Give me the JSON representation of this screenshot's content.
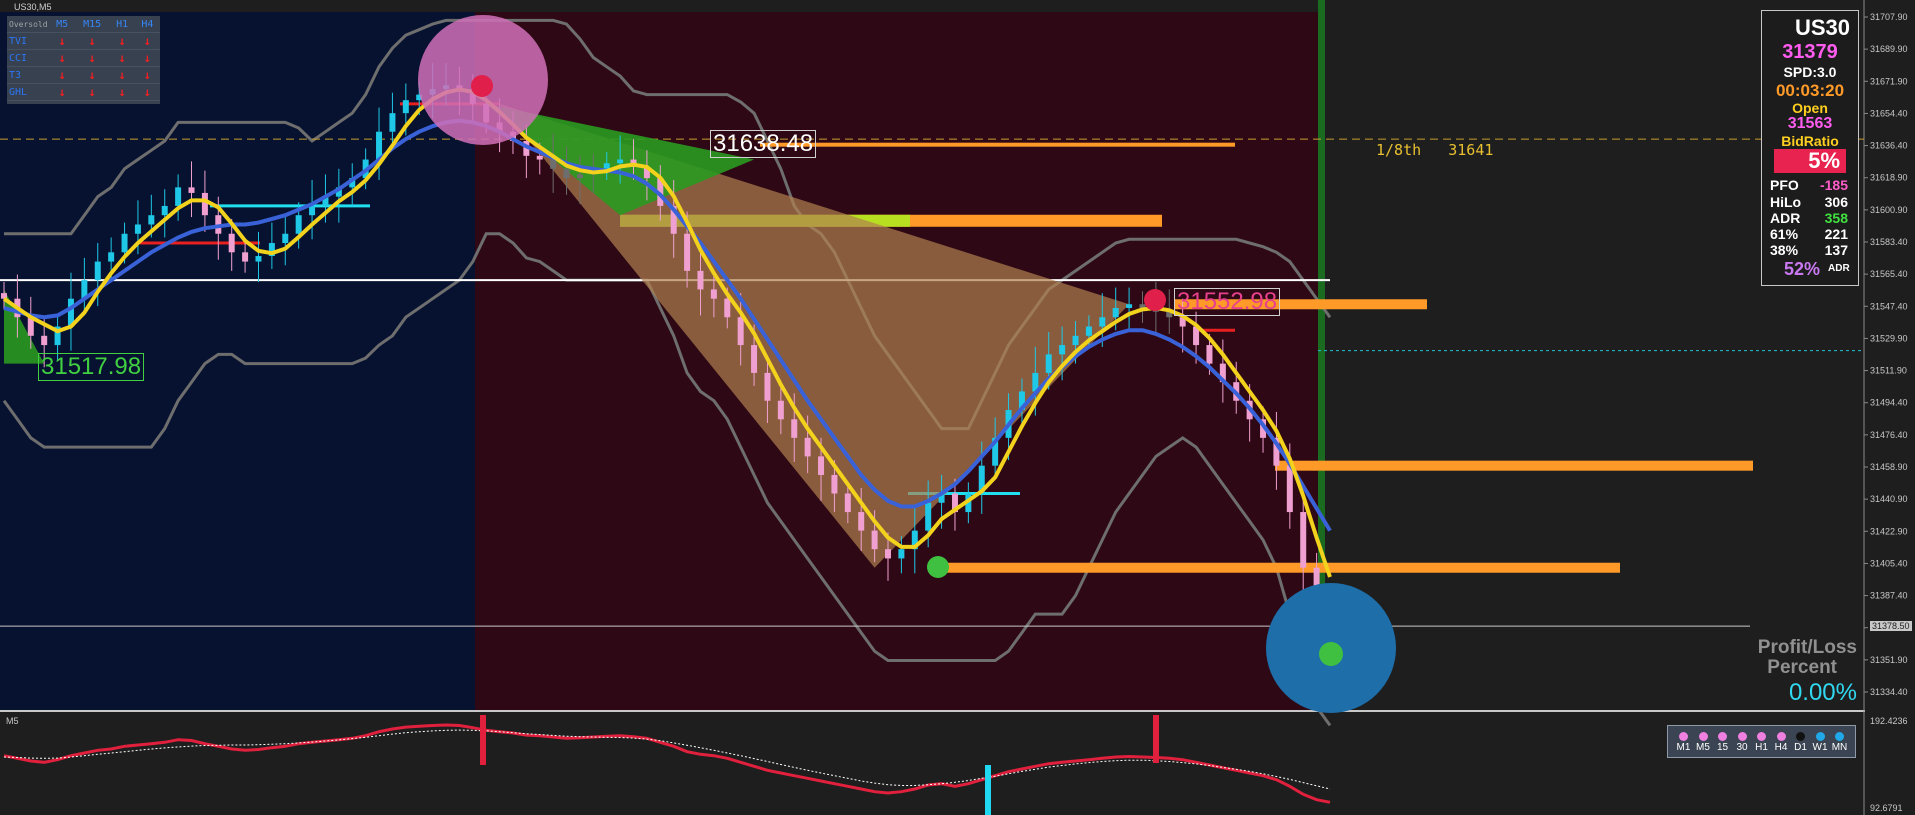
{
  "window": {
    "title": "US30,M5"
  },
  "colors": {
    "bg_left": "#071230",
    "bg_right": "#2e0814",
    "bg_panel": "#1e1e1e",
    "bull_candle": "#1ec8e6",
    "bear_candle": "#f0a0d0",
    "neutral_candle": "#6e6e6e",
    "ma_blue": "#3a62d8",
    "ma_yellow": "#f2d21c",
    "channel": "#6e6e6e",
    "orange_level": "#ff9a28",
    "lime_level": "#b8e020",
    "cyan_level": "#20e0f0",
    "red_level": "#e82020",
    "oscillator_cyan": "#20d8f0",
    "oscillator_red": "#e0203c"
  },
  "signal_table": {
    "header": [
      "Oversold",
      "M5",
      "M15",
      "H1",
      "H4"
    ],
    "rows": [
      {
        "name": "TVI",
        "arrows": [
          "↓",
          "↓",
          "↓",
          "↓"
        ]
      },
      {
        "name": "CCI",
        "arrows": [
          "↓",
          "↓",
          "↓",
          "↓"
        ]
      },
      {
        "name": "T3",
        "arrows": [
          "↓",
          "↓",
          "↓",
          "↓"
        ]
      },
      {
        "name": "GHL",
        "arrows": [
          "↓",
          "↓",
          "↓",
          "↓"
        ]
      }
    ]
  },
  "chart_labels": {
    "level_31638": "31638.48",
    "level_31552": "31552.98",
    "level_31517": "31517.98",
    "murrey_label": "1/8th",
    "murrey_value": "31641",
    "current_price_tag": "31378.50",
    "pl_title_1": "Profit/Loss",
    "pl_title_2": "Percent",
    "pl_value": "0.00%"
  },
  "info_panel": {
    "symbol": "US30",
    "price": "31379",
    "spread": "SPD:3.0",
    "timer": "00:03:20",
    "open_label": "Open",
    "open_value": "31563",
    "bid_ratio_label": "BidRatio",
    "bid_ratio_value": "5%",
    "stats": [
      {
        "label": "PFO",
        "value": "-185",
        "color": "#ff5cc8"
      },
      {
        "label": "HiLo",
        "value": "306",
        "color": "#ffffff"
      },
      {
        "label": "ADR",
        "value": "358",
        "color": "#40e040"
      },
      {
        "label": "61%",
        "value": "221",
        "color": "#ffffff"
      },
      {
        "label": "38%",
        "value": "137",
        "color": "#ffffff"
      }
    ],
    "adr_percent": "52%",
    "adr_suffix": "ADR"
  },
  "timeframes": [
    {
      "label": "M1",
      "color": "#f080e0"
    },
    {
      "label": "M5",
      "color": "#f080e0"
    },
    {
      "label": "15",
      "color": "#f080e0"
    },
    {
      "label": "30",
      "color": "#f080e0"
    },
    {
      "label": "H1",
      "color": "#f080e0"
    },
    {
      "label": "H4",
      "color": "#f080e0"
    },
    {
      "label": "D1",
      "color": "#111111"
    },
    {
      "label": "W1",
      "color": "#20a8e8"
    },
    {
      "label": "MN",
      "color": "#20a8e8"
    }
  ],
  "subwindow": {
    "label": "M5",
    "max": "192.4236",
    "min": "92.6791"
  },
  "chart_data": {
    "type": "line",
    "title": "",
    "price_axis_ticks": [
      "31707.90",
      "31689.90",
      "31671.90",
      "31654.40",
      "31636.40",
      "31618.90",
      "31600.90",
      "31583.40",
      "31565.40",
      "31547.40",
      "31529.90",
      "31511.90",
      "31494.40",
      "31476.40",
      "31458.90",
      "31440.90",
      "31422.90",
      "31405.40",
      "31387.40",
      "31369.90",
      "31351.90",
      "31334.40"
    ],
    "ylim": [
      31334.4,
      31707.9
    ],
    "bar_count": 126,
    "levels": [
      {
        "name": "murrey-1-8th",
        "value": 31641,
        "style": "dashed",
        "color": "#c8a030"
      },
      {
        "name": "white-line",
        "value": 31565,
        "style": "solid",
        "color": "#ffffff"
      },
      {
        "name": "current-price",
        "value": 31378.5,
        "style": "solid",
        "color": "#c8c8c8"
      },
      {
        "name": "orange-upper",
        "value": 31638,
        "color": "#ff9a28"
      },
      {
        "name": "orange-mid",
        "value": 31597,
        "color": "#ff9a28"
      },
      {
        "name": "orange-552",
        "value": 31552,
        "color": "#ff9a28"
      },
      {
        "name": "orange-470",
        "value": 31465,
        "color": "#ff9a28"
      },
      {
        "name": "orange-410",
        "value": 31410,
        "color": "#ff9a28"
      }
    ],
    "series": [
      {
        "name": "close",
        "values": [
          31555,
          31545,
          31535,
          31530,
          31540,
          31555,
          31565,
          31575,
          31580,
          31590,
          31595,
          31600,
          31605,
          31615,
          31612,
          31600,
          31590,
          31580,
          31575,
          31578,
          31585,
          31590,
          31600,
          31605,
          31610,
          31615,
          31620,
          31630,
          31645,
          31655,
          31662,
          31665,
          31668,
          31670,
          31668,
          31660,
          31650,
          31645,
          31640,
          31632,
          31630,
          31625,
          31620,
          31622,
          31625,
          31628,
          31630,
          31626,
          31620,
          31605,
          31590,
          31570,
          31560,
          31555,
          31545,
          31530,
          31515,
          31500,
          31490,
          31480,
          31470,
          31460,
          31450,
          31440,
          31430,
          31420,
          31415,
          31420,
          31430,
          31445,
          31450,
          31440,
          31450,
          31465,
          31480,
          31495,
          31505,
          31515,
          31525,
          31530,
          31535,
          31540,
          31545,
          31550,
          31552,
          31550,
          31548,
          31545,
          31540,
          31530,
          31520,
          31510,
          31500,
          31490,
          31480,
          31465,
          31440,
          31410,
          31390,
          31380
        ]
      },
      {
        "name": "ma-blue",
        "values": [
          31550,
          31548,
          31546,
          31545,
          31546,
          31550,
          31555,
          31560,
          31565,
          31570,
          31575,
          31580,
          31584,
          31588,
          31591,
          31593,
          31594,
          31595,
          31595,
          31596,
          31598,
          31600,
          31603,
          31606,
          31610,
          31614,
          31619,
          31624,
          31630,
          31636,
          31641,
          31645,
          31648,
          31650,
          31651,
          31650,
          31648,
          31645,
          31641,
          31637,
          31634,
          31631,
          31628,
          31626,
          31625,
          31624,
          31623,
          31621,
          31617,
          31611,
          31603,
          31594,
          31585,
          31575,
          31565,
          31555,
          31544,
          31533,
          31522,
          31511,
          31500,
          31490,
          31480,
          31470,
          31460,
          31452,
          31446,
          31443,
          31443,
          31446,
          31450,
          31455,
          31462,
          31470,
          31478,
          31487,
          31496,
          31504,
          31512,
          31518,
          31524,
          31529,
          31533,
          31536,
          31538,
          31538,
          31536,
          31533,
          31529,
          31524,
          31518,
          31511,
          31504,
          31496,
          31487,
          31477,
          31466,
          31454,
          31442,
          31430
        ]
      }
    ]
  }
}
